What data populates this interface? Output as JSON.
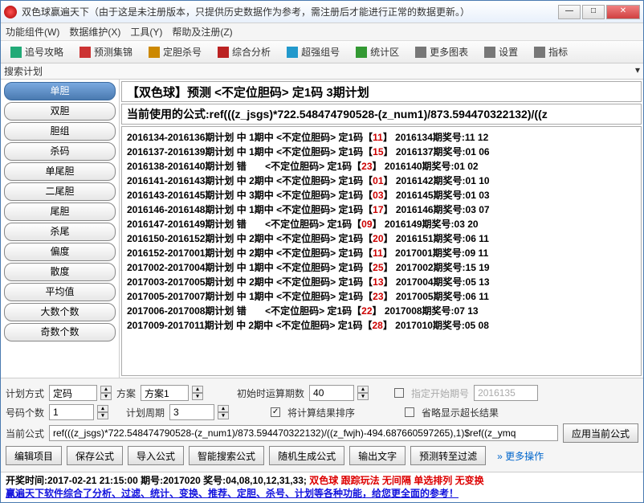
{
  "title": "双色球赢遍天下（由于这是未注册版本，只提供历史数据作为参考，需注册后才能进行正常的数据更新。）",
  "menubar": [
    "功能组件(W)",
    "数据维护(X)",
    "工具(Y)",
    "帮助及注册(Z)"
  ],
  "toolbar": [
    {
      "label": "追号攻略",
      "color": "#2a7"
    },
    {
      "label": "预测集锦",
      "color": "#c33"
    },
    {
      "label": "定胆杀号",
      "color": "#c80"
    },
    {
      "label": "综合分析",
      "color": "#b22"
    },
    {
      "label": "超强组号",
      "color": "#29c"
    },
    {
      "label": "统计区",
      "color": "#393"
    },
    {
      "label": "更多图表",
      "color": "#777"
    },
    {
      "label": "设置",
      "color": "#777"
    },
    {
      "label": "指标",
      "color": "#777"
    }
  ],
  "searchbar_label": "搜索计划",
  "sidebar": [
    "单胆",
    "双胆",
    "胆组",
    "杀码",
    "单尾胆",
    "二尾胆",
    "尾胆",
    "杀尾",
    "偏度",
    "散度",
    "平均值",
    "大数个数",
    "奇数个数"
  ],
  "sidebar_active": 0,
  "content_head": "【双色球】预测 <不定位胆码> 定1码 3期计划",
  "formula": "当前使用的公式:ref(((z_jsgs)*722.548474790528-(z_num1)/873.594470322132)/((z",
  "rows": [
    {
      "range": "2016134-2016136期计划",
      "res": "中",
      "hit": "1期中",
      "type": "<不定位胆码>",
      "pick": "定1码",
      "num": "11",
      "issue": "2016134期奖号",
      "kj": "11 12"
    },
    {
      "range": "2016137-2016139期计划",
      "res": "中",
      "hit": "1期中",
      "type": "<不定位胆码>",
      "pick": "定1码",
      "num": "15",
      "issue": "2016137期奖号",
      "kj": "01 06"
    },
    {
      "range": "2016138-2016140期计划",
      "res": "错",
      "hit": "",
      "type": "<不定位胆码>",
      "pick": "定1码",
      "num": "23",
      "issue": "2016140期奖号",
      "kj": "01 02"
    },
    {
      "range": "2016141-2016143期计划",
      "res": "中",
      "hit": "2期中",
      "type": "<不定位胆码>",
      "pick": "定1码",
      "num": "01",
      "issue": "2016142期奖号",
      "kj": "01 10"
    },
    {
      "range": "2016143-2016145期计划",
      "res": "中",
      "hit": "3期中",
      "type": "<不定位胆码>",
      "pick": "定1码",
      "num": "03",
      "issue": "2016145期奖号",
      "kj": "01 03"
    },
    {
      "range": "2016146-2016148期计划",
      "res": "中",
      "hit": "1期中",
      "type": "<不定位胆码>",
      "pick": "定1码",
      "num": "17",
      "issue": "2016146期奖号",
      "kj": "03 07"
    },
    {
      "range": "2016147-2016149期计划",
      "res": "错",
      "hit": "",
      "type": "<不定位胆码>",
      "pick": "定1码",
      "num": "09",
      "issue": "2016149期奖号",
      "kj": "03 20"
    },
    {
      "range": "2016150-2016152期计划",
      "res": "中",
      "hit": "2期中",
      "type": "<不定位胆码>",
      "pick": "定1码",
      "num": "20",
      "issue": "2016151期奖号",
      "kj": "06 11"
    },
    {
      "range": "2016152-2017001期计划",
      "res": "中",
      "hit": "2期中",
      "type": "<不定位胆码>",
      "pick": "定1码",
      "num": "11",
      "issue": "2017001期奖号",
      "kj": "09 11"
    },
    {
      "range": "2017002-2017004期计划",
      "res": "中",
      "hit": "1期中",
      "type": "<不定位胆码>",
      "pick": "定1码",
      "num": "25",
      "issue": "2017002期奖号",
      "kj": "15 19"
    },
    {
      "range": "2017003-2017005期计划",
      "res": "中",
      "hit": "2期中",
      "type": "<不定位胆码>",
      "pick": "定1码",
      "num": "13",
      "issue": "2017004期奖号",
      "kj": "05 13"
    },
    {
      "range": "2017005-2017007期计划",
      "res": "中",
      "hit": "1期中",
      "type": "<不定位胆码>",
      "pick": "定1码",
      "num": "23",
      "issue": "2017005期奖号",
      "kj": "06 11"
    },
    {
      "range": "2017006-2017008期计划",
      "res": "错",
      "hit": "",
      "type": "<不定位胆码>",
      "pick": "定1码",
      "num": "22",
      "issue": "2017008期奖号",
      "kj": "07 13"
    },
    {
      "range": "2017009-2017011期计划",
      "res": "中",
      "hit": "2期中",
      "type": "<不定位胆码>",
      "pick": "定1码",
      "num": "28",
      "issue": "2017010期奖号",
      "kj": "05 08"
    }
  ],
  "form": {
    "plan_mode_label": "计划方式",
    "plan_mode_value": "定码",
    "scheme_label": "方案",
    "scheme_value": "方案1",
    "start_label": "初始时运算期数",
    "start_value": "40",
    "start_issue_label": "指定开始期号",
    "start_issue_value": "2016135",
    "count_label": "号码个数",
    "count_value": "1",
    "period_label": "计划周期",
    "period_value": "3",
    "sort_label": "将计算结果排序",
    "sort_checked": true,
    "brief_label": "省略显示超长结果",
    "brief_checked": false,
    "curr_formula_label": "当前公式",
    "curr_formula_value": "ref(((z_jsgs)*722.548474790528-(z_num1)/873.594470322132)/((z_fwjh)-494.687660597265),1)$ref((z_ymq",
    "apply_btn": "应用当前公式",
    "buttons": [
      "编辑项目",
      "保存公式",
      "导入公式",
      "智能搜索公式",
      "随机生成公式",
      "输出文字",
      "预测转至过滤"
    ],
    "more_label": "更多操作"
  },
  "status1": {
    "a": "开奖时间:2017-02-21 21:15:00 期号:2017020 奖号:04,08,10,12,31,33;",
    "b": "双色球  跟踪玩法  无间隔  单选排列  无变换"
  },
  "status2": "赢遍天下软件综合了分析、过滤、统计、变换、推荐、定胆、杀号、计划等各种功能，给您更全面的参考！"
}
